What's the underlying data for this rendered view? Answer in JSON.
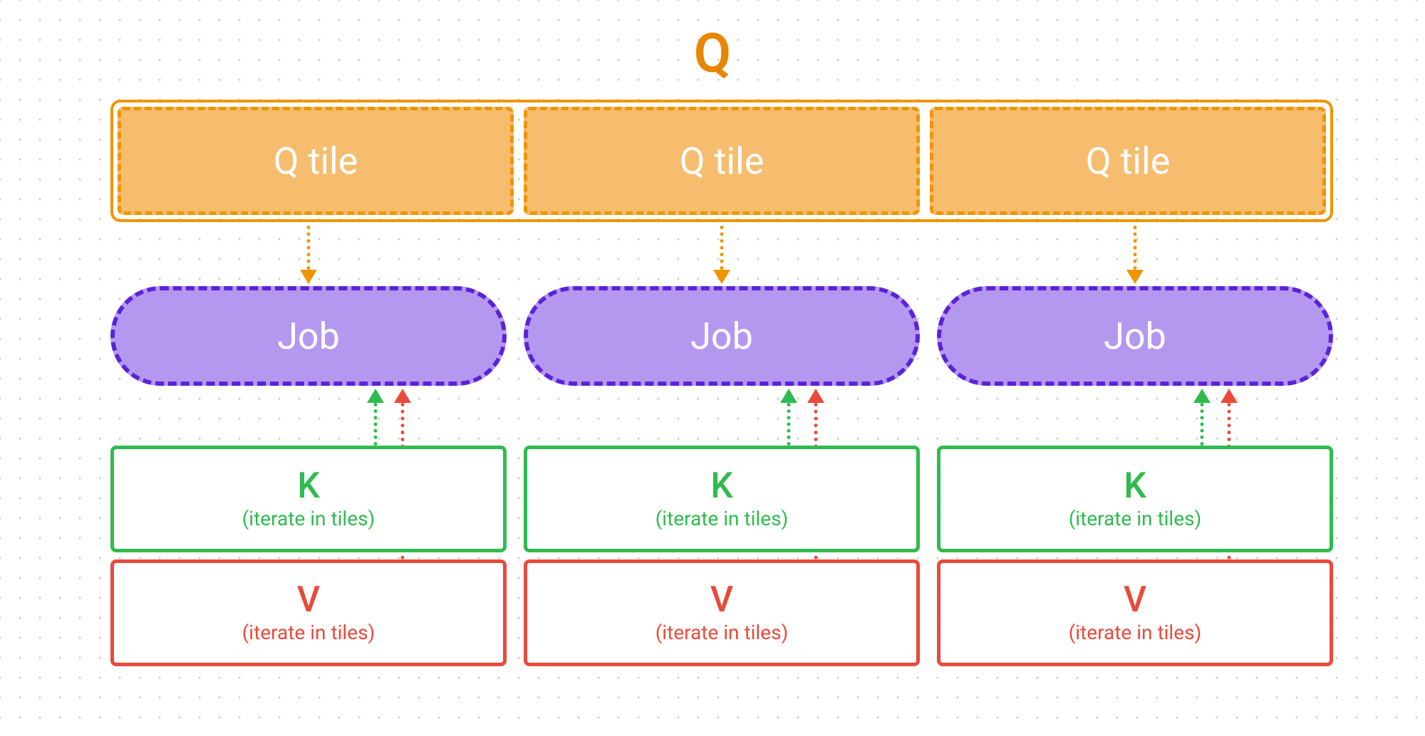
{
  "title": "Q",
  "q_container": {
    "tiles": [
      {
        "label": "Q tile"
      },
      {
        "label": "Q tile"
      },
      {
        "label": "Q tile"
      }
    ]
  },
  "columns": [
    {
      "job_label": "Job",
      "k_label": "K",
      "k_sub": "(iterate in tiles)",
      "v_label": "V",
      "v_sub": "(iterate in tiles)"
    },
    {
      "job_label": "Job",
      "k_label": "K",
      "k_sub": "(iterate in tiles)",
      "v_label": "V",
      "v_sub": "(iterate in tiles)"
    },
    {
      "job_label": "Job",
      "k_label": "K",
      "k_sub": "(iterate in tiles)",
      "v_label": "V",
      "v_sub": "(iterate in tiles)"
    }
  ],
  "colors": {
    "orange": "#ef9500",
    "orange_fill": "#f6bd6f",
    "purple": "#5b23d8",
    "purple_fill": "#b498f0",
    "green": "#2fbb4f",
    "red": "#ea4a3b"
  }
}
